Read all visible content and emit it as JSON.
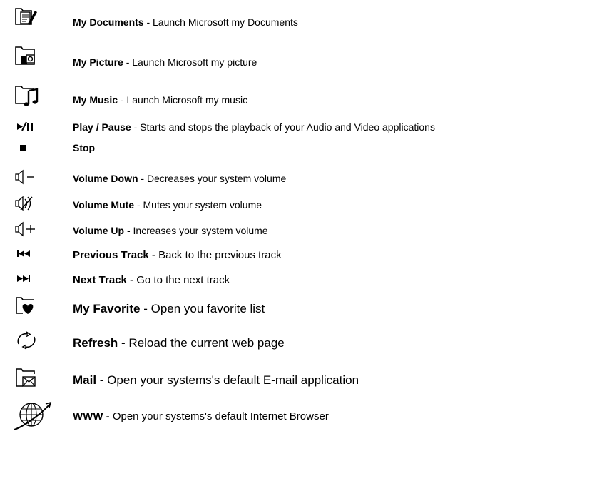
{
  "items": [
    {
      "icon": "documents-folder-icon",
      "title": "My Documents",
      "desc": " - Launch Microsoft my Documents"
    },
    {
      "icon": "picture-folder-icon",
      "title": "My Picture",
      "desc": " - Launch Microsoft my picture"
    },
    {
      "icon": "music-folder-icon",
      "title": "My Music",
      "desc": " - Launch Microsoft my music"
    },
    {
      "icon": "play-pause-icon",
      "title": "Play / Pause",
      "desc": " - Starts and stops the playback of  your Audio and Video applications"
    },
    {
      "icon": "stop-icon",
      "title": "Stop",
      "desc": ""
    },
    {
      "icon": "volume-down-icon",
      "title": "Volume Down",
      "desc": " - Decreases your system volume"
    },
    {
      "icon": "volume-mute-icon",
      "title": "Volume Mute",
      "desc": " - Mutes your system volume"
    },
    {
      "icon": "volume-up-icon",
      "title": "Volume Up",
      "desc": " - Increases your system volume"
    },
    {
      "icon": "previous-track-icon",
      "title": "Previous Track",
      "desc": " - Back to the previous track"
    },
    {
      "icon": "next-track-icon",
      "title": "Next Track",
      "desc": " - Go to the next track"
    },
    {
      "icon": "favorite-folder-icon",
      "title": "My Favorite",
      "desc": " - Open you favorite list"
    },
    {
      "icon": "refresh-icon",
      "title": "Refresh",
      "desc": " - Reload the current web page"
    },
    {
      "icon": "mail-folder-icon",
      "title": "Mail",
      "desc": " - Open your systems's default E-mail application"
    },
    {
      "icon": "globe-icon",
      "title": "WWW",
      "desc": " - Open your systems's default Internet Browser"
    }
  ]
}
